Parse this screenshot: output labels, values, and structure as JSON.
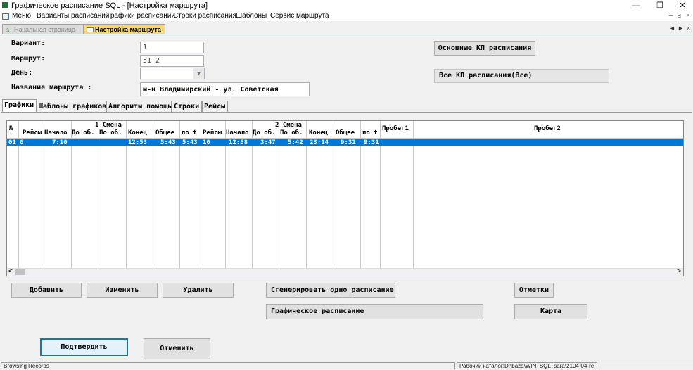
{
  "window": {
    "title": "Графическое расписание SQL - [Настройка маршрута]",
    "minimize": "—",
    "restore": "❐",
    "close": "✕"
  },
  "menu": {
    "items": [
      "Меню",
      "Варианты расписаний",
      "Графики расписаний",
      "Строки расписания",
      "Шаблоны",
      "Сервис маршрута"
    ],
    "mdi_min": "–",
    "mdi_restore": "ⅎ",
    "mdi_close": "×"
  },
  "tabs": {
    "home": "Начальная страница",
    "active": "Настройка маршрута",
    "prev": "◄",
    "next": "►",
    "close": "×"
  },
  "form": {
    "variant_label": "Вариант:",
    "variant_value": "1",
    "route_label": "Маршрут:",
    "route_value": "51  2",
    "day_label": "День:",
    "day_value": "",
    "route_name_label": "Название маршрута :",
    "route_name_value": "м-н Владимирский - ул. Советская",
    "btn_main_kp": "Основные КП расписания",
    "all_kp": "Все КП расписания(Все)"
  },
  "inner_tabs": [
    "Графики",
    "Шаблоны графиков",
    "Алгоритм помощь",
    "Строки",
    "Рейсы"
  ],
  "table": {
    "num_header": "№",
    "shift1": "1 Смена",
    "shift2": "2 Смена",
    "columns": [
      "Рейсы",
      "Начало",
      "До об.",
      "По об.",
      "Конец",
      "Общее",
      "по t",
      "Рейсы",
      "Начало",
      "До об.",
      "По об.",
      "Конец",
      "Общее",
      "по t"
    ],
    "probeg1": "Пробег1",
    "probeg2": "Пробег2",
    "rows": [
      {
        "num": "01",
        "cells": [
          "6",
          "7:10",
          "",
          "",
          "12:53",
          "5:43",
          "5:43",
          "10",
          "12:58",
          "3:47",
          "5:42",
          "23:14",
          "9:31",
          "9:31"
        ],
        "probeg1": "",
        "probeg2": ""
      }
    ],
    "scroll_left": "<",
    "scroll_right": ">"
  },
  "actions": {
    "add": "Добавить",
    "edit": "Изменить",
    "delete": "Удалить",
    "generate": "Сгенерировать одно расписание",
    "marks": "Отметки",
    "graphic": "Графическое расписание",
    "map": "Карта"
  },
  "footer": {
    "confirm": "Подтвердить",
    "cancel": "Отменить"
  },
  "status": {
    "left": "Browsing Records",
    "right": "Рабочий каталог:D:\\baza\\WIN_SQL_sara\\2104-04-re"
  }
}
